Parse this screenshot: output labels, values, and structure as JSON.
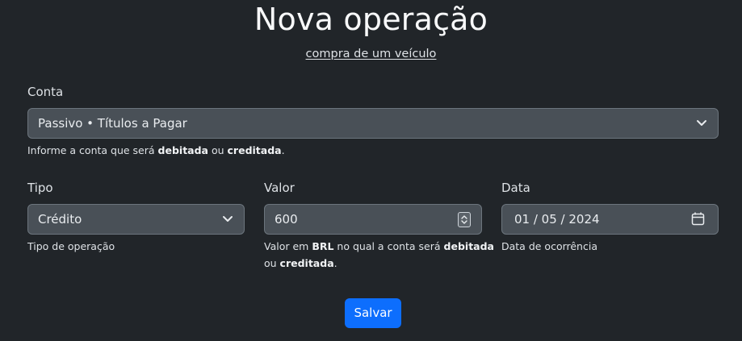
{
  "header": {
    "title": "Nova operação",
    "subtitle_link": "compra de um veículo"
  },
  "conta": {
    "label": "Conta",
    "selected": "Passivo • Títulos a Pagar",
    "help_prefix": "Informe a conta que será ",
    "help_bold1": "debitada",
    "help_mid": " ou ",
    "help_bold2": "creditada",
    "help_suffix": "."
  },
  "tipo": {
    "label": "Tipo",
    "selected": "Crédito",
    "help": "Tipo de operação"
  },
  "valor": {
    "label": "Valor",
    "value": "600",
    "help_prefix": "Valor em ",
    "help_currency": "BRL",
    "help_mid": " no qual a conta será ",
    "help_bold1": "debitada",
    "help_line2_prefix": "ou ",
    "help_bold2": "creditada",
    "help_suffix": "."
  },
  "data": {
    "label": "Data",
    "value": "01 / 05 / 2024",
    "help": "Data de ocorrência"
  },
  "actions": {
    "save_label": "Salvar"
  },
  "colors": {
    "background": "#212529",
    "field_bg": "#495057",
    "accent": "#0d6efd"
  },
  "icons": {
    "conta_select": "chevron-down-icon",
    "tipo_select": "chevron-down-icon",
    "valor_spinner": "number-spinner-icon",
    "data_picker": "calendar-icon"
  }
}
